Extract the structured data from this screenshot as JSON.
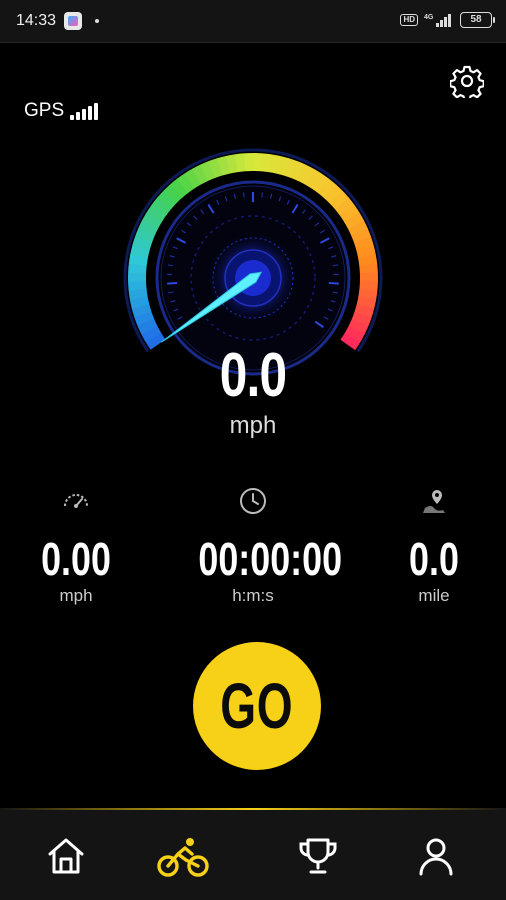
{
  "status_bar": {
    "time": "14:33",
    "hd_label": "HD",
    "network": "4G",
    "battery": "58"
  },
  "gps": {
    "label": "GPS"
  },
  "gauge": {
    "speed": "0.0",
    "unit": "mph",
    "needle_fraction": 0,
    "arc_colors": [
      "#1f6ee8",
      "#2fc8d8",
      "#45d24a",
      "#d8e83a",
      "#f8c62e",
      "#ff8a1e",
      "#ff2a5c"
    ]
  },
  "stats": [
    {
      "icon": "speedometer-icon",
      "value": "0.00",
      "unit": "mph"
    },
    {
      "icon": "clock-icon",
      "value": "00:00:00",
      "unit": "h:m:s"
    },
    {
      "icon": "location-pin-icon",
      "value": "0.0",
      "unit": "mile"
    }
  ],
  "go_button": {
    "label": "GO",
    "color": "#f7d117"
  },
  "nav": {
    "items": [
      {
        "icon": "home-icon",
        "active": false
      },
      {
        "icon": "bicycle-icon",
        "active": true
      },
      {
        "icon": "trophy-icon",
        "active": false
      },
      {
        "icon": "profile-icon",
        "active": false
      }
    ],
    "active_color": "#f7d117"
  }
}
